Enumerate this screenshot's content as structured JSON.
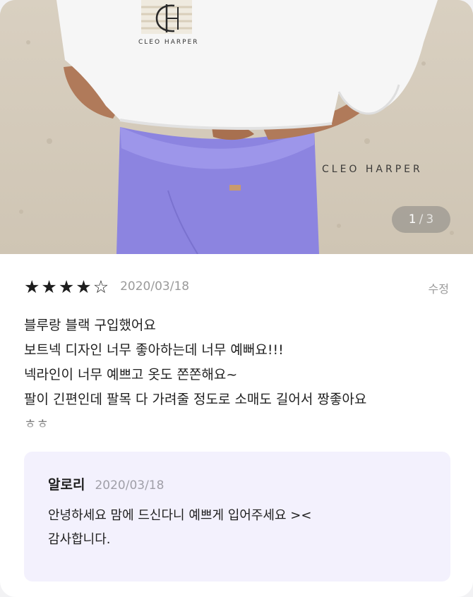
{
  "photo": {
    "logo_text": "CLEO HARPER",
    "watermark": "CLEO HARPER",
    "pager": {
      "current": "1",
      "separator": "/",
      "total": "3"
    }
  },
  "review": {
    "rating": 4,
    "max_rating": 5,
    "stars": [
      "★",
      "★",
      "★",
      "★",
      "☆"
    ],
    "date": "2020/03/18",
    "edit_label": "수정",
    "lines": [
      "블루랑 블랙 구입했어요",
      "보트넥 디자인 너무 좋아하는데 너무 예뻐요!!!",
      "넥라인이 너무 예쁘고 옷도 쫀쫀해요~",
      "팔이 긴편인데 팔목 다 가려줄 정도로 소매도 길어서 짱좋아요",
      "ㅎㅎ"
    ]
  },
  "reply": {
    "name": "알로리",
    "date": "2020/03/18",
    "lines": [
      "안녕하세요 맘에 드신다니 예쁘게 입어주세요 ><",
      "감사합니다."
    ]
  }
}
